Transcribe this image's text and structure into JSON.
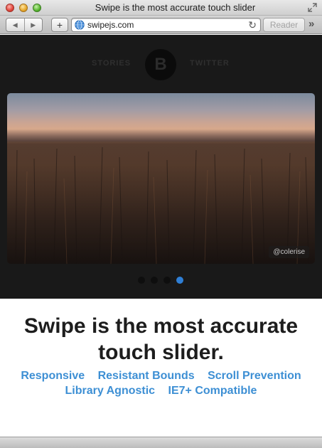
{
  "window": {
    "title": "Swipe is the most accurate touch slider"
  },
  "toolbar": {
    "back_icon": "back-arrow",
    "forward_icon": "forward-arrow",
    "plus_label": "+",
    "url": "swipejs.com",
    "reload_icon": "↻",
    "reader_label": "Reader",
    "overflow_icon": "»"
  },
  "site_nav": {
    "left_link": "STORIES",
    "logo_letter": "B",
    "right_link": "TWITTER"
  },
  "slider": {
    "photo_credit": "@colerise",
    "total_slides": 4,
    "active_slide": 4,
    "active_dot_color": "#2f7fd6"
  },
  "main": {
    "headline_line1": "Swipe is the most accurate",
    "headline_line2": "touch slider.",
    "features": [
      "Responsive",
      "Resistant Bounds",
      "Scroll Prevention",
      "Library Agnostic",
      "IE7+ Compatible"
    ],
    "feature_color": "#3d8fd4"
  }
}
